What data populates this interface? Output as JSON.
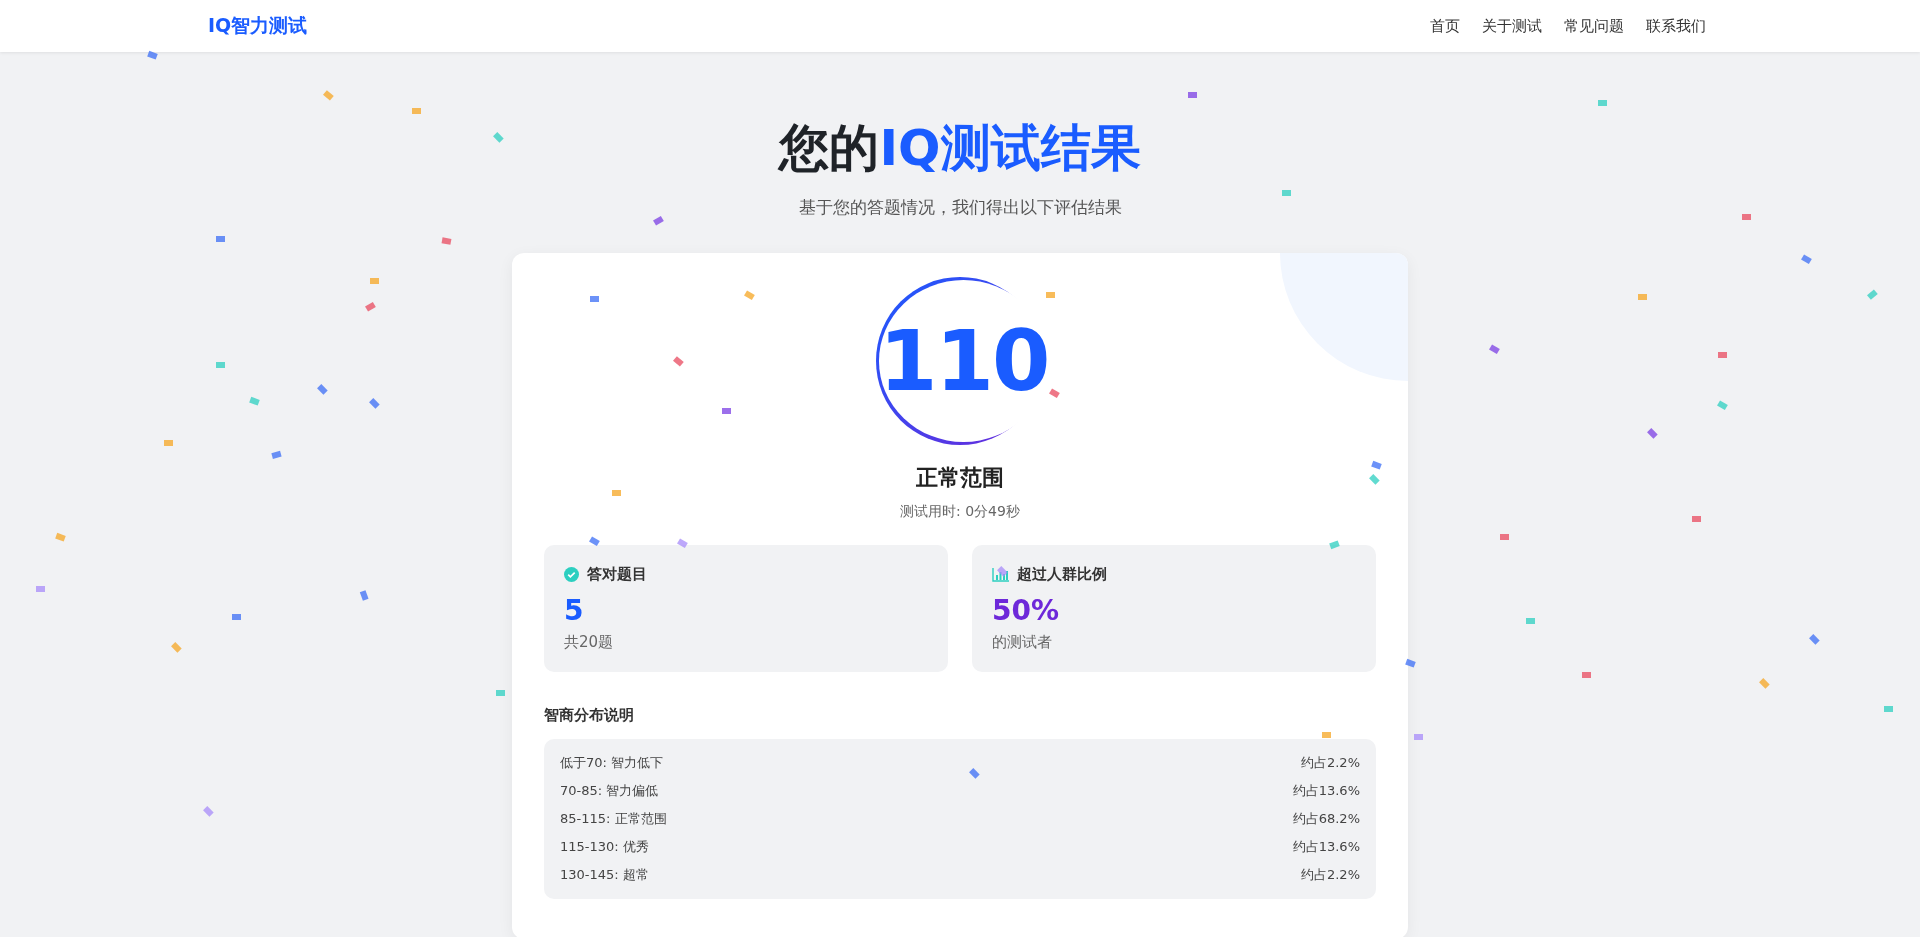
{
  "header": {
    "logo": "IQ智力测试",
    "nav": [
      "首页",
      "关于测试",
      "常见问题",
      "联系我们"
    ]
  },
  "hero": {
    "title_plain": "您的",
    "title_highlight": "IQ测试结果",
    "subtitle": "基于您的答题情况，我们得出以下评估结果"
  },
  "result": {
    "score": "110",
    "category": "正常范围",
    "duration": "测试用时: 0分49秒"
  },
  "stats": [
    {
      "kind": "check",
      "title": "答对题目",
      "value": "5",
      "note": "共20题",
      "color": "#1a5cff"
    },
    {
      "kind": "chart",
      "title": "超过人群比例",
      "value": "50%",
      "note": "的测试者",
      "color": "#6d28d9"
    }
  ],
  "distribution": {
    "title": "智商分布说明",
    "rows": [
      {
        "range": "低于70: 智力低下",
        "share": "约占2.2%"
      },
      {
        "range": "70-85: 智力偏低",
        "share": "约占13.6%"
      },
      {
        "range": "85-115: 正常范围",
        "share": "约占68.2%"
      },
      {
        "range": "115-130: 优秀",
        "share": "约占13.6%"
      },
      {
        "range": "130-145: 超常",
        "share": "约占2.2%"
      }
    ]
  }
}
